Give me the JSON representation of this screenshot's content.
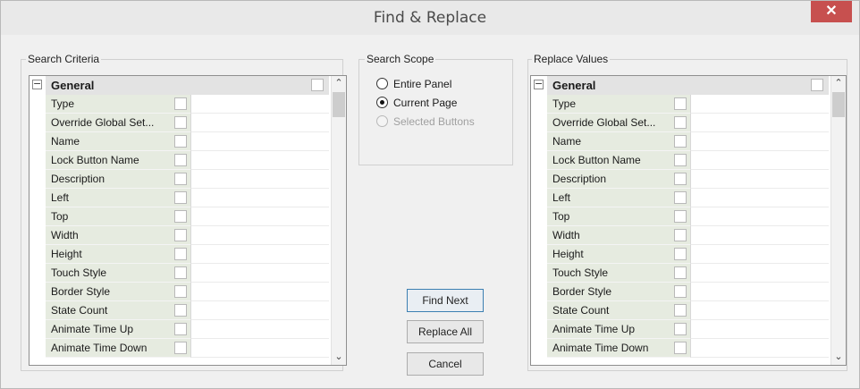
{
  "window": {
    "title": "Find & Replace",
    "close_glyph": "✕"
  },
  "search_criteria": {
    "label": "Search Criteria",
    "category": "General",
    "rows": [
      "Type",
      "Override Global Set...",
      "Name",
      "Lock Button Name",
      "Description",
      "Left",
      "Top",
      "Width",
      "Height",
      "Touch Style",
      "Border Style",
      "State Count",
      "Animate Time Up",
      "Animate Time Down"
    ]
  },
  "search_scope": {
    "label": "Search Scope",
    "options": [
      {
        "label": "Entire Panel",
        "checked": false,
        "disabled": false
      },
      {
        "label": "Current Page",
        "checked": true,
        "disabled": false
      },
      {
        "label": "Selected Buttons",
        "checked": false,
        "disabled": true
      }
    ]
  },
  "replace_values": {
    "label": "Replace Values",
    "category": "General",
    "rows": [
      "Type",
      "Override Global Set...",
      "Name",
      "Lock Button Name",
      "Description",
      "Left",
      "Top",
      "Width",
      "Height",
      "Touch Style",
      "Border Style",
      "State Count",
      "Animate Time Up",
      "Animate Time Down"
    ]
  },
  "buttons": {
    "find_next": "Find Next",
    "replace_all": "Replace All",
    "cancel": "Cancel"
  },
  "icons": {
    "expander": "minus-square-icon",
    "scroll_up": "chevron-up-icon",
    "scroll_down": "chevron-down-icon",
    "close": "close-icon"
  },
  "colors": {
    "close_button": "#c7504f",
    "name_cell": "#e6ebe0",
    "category_row": "#e3e3e3"
  }
}
